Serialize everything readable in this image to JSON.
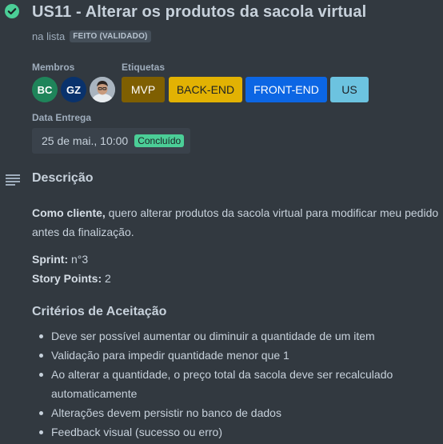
{
  "card": {
    "title": "US11 - Alterar os produtos da sacola virtual",
    "in_list_prefix": "na lista",
    "list_name": "FEITO (VALIDADO)",
    "status_icon": "check-circle-icon",
    "status_icon_color": "#4bce97"
  },
  "members": {
    "label": "Membros",
    "items": [
      {
        "initials": "BC",
        "color": "#1f845a"
      },
      {
        "initials": "GZ",
        "color": "#09326c"
      },
      {
        "initials": "",
        "color": "#8c9bab",
        "type": "photo"
      }
    ]
  },
  "labels": {
    "label": "Etiquetas",
    "items": [
      {
        "text": "MVP",
        "bg": "#7f5f01",
        "fg": "#ffffff"
      },
      {
        "text": "BACK-END",
        "bg": "#e2b203",
        "fg": "#1d2125"
      },
      {
        "text": "FRONT-END",
        "bg": "#0c66e4",
        "fg": "#ffffff"
      },
      {
        "text": "US",
        "bg": "#6cc3e0",
        "fg": "#1d2125"
      }
    ]
  },
  "due_date": {
    "label": "Data Entrega",
    "value": "25 de mai., 10:00",
    "status": "Concluído",
    "status_color": "#4bce97"
  },
  "description": {
    "heading": "Descrição",
    "icon": "text-lines-icon",
    "role_bold": "Como cliente,",
    "role_text": " quero alterar produtos da sacola virtual para modificar meu pedido antes da finalização.",
    "sprint_label": "Sprint:",
    "sprint_value": " n°3",
    "points_label": "Story Points:",
    "points_value": " 2"
  },
  "criteria": {
    "heading": "Critérios de Aceitação",
    "items": [
      "Deve ser possível aumentar ou diminuir a quantidade de um item",
      "Validação para impedir quantidade menor que 1",
      "Ao alterar a quantidade, o preço total da sacola deve ser recalculado automaticamente",
      "Alterações devem persistir no banco de dados",
      "Feedback visual (sucesso ou erro)"
    ]
  }
}
